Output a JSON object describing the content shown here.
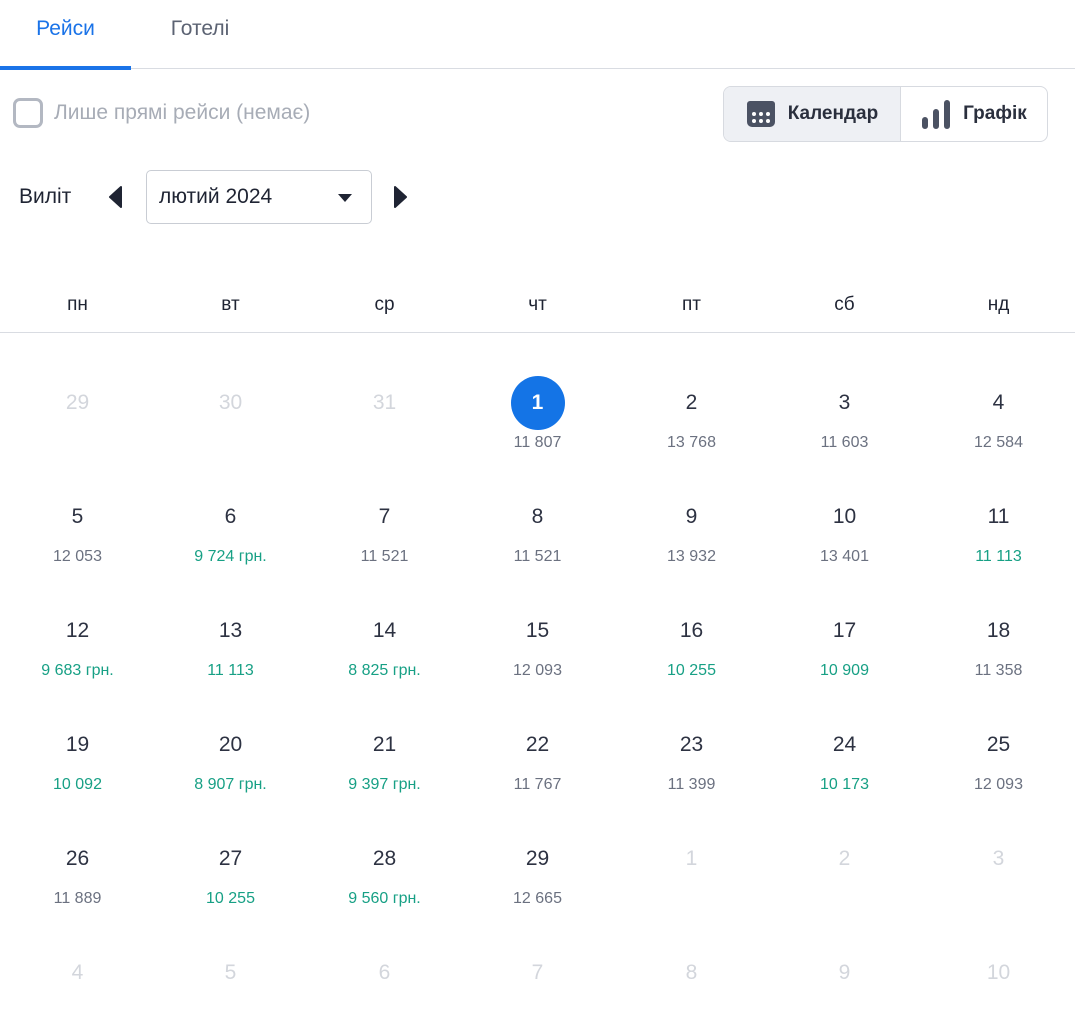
{
  "tabs": [
    {
      "label": "Рейси",
      "active": true
    },
    {
      "label": "Готелі",
      "active": false
    }
  ],
  "filters": {
    "direct_label": "Лише прямі рейси (немає)",
    "direct_checked": false
  },
  "view_toggle": {
    "calendar_label": "Календар",
    "chart_label": "Графік",
    "active": "calendar"
  },
  "departure": {
    "label": "Виліт",
    "month": "лютий 2024"
  },
  "weekdays": [
    "пн",
    "вт",
    "ср",
    "чт",
    "пт",
    "сб",
    "нд"
  ],
  "colors": {
    "accent": "#1a73e8",
    "selected": "#1474e6",
    "low_price": "#17a085"
  },
  "calendar": [
    {
      "day": "29",
      "muted": true
    },
    {
      "day": "30",
      "muted": true
    },
    {
      "day": "31",
      "muted": true
    },
    {
      "day": "1",
      "price": "11 807",
      "selected": true
    },
    {
      "day": "2",
      "price": "13 768"
    },
    {
      "day": "3",
      "price": "11 603"
    },
    {
      "day": "4",
      "price": "12 584"
    },
    {
      "day": "5",
      "price": "12 053"
    },
    {
      "day": "6",
      "price": "9 724 грн.",
      "low": true
    },
    {
      "day": "7",
      "price": "11 521"
    },
    {
      "day": "8",
      "price": "11 521"
    },
    {
      "day": "9",
      "price": "13 932"
    },
    {
      "day": "10",
      "price": "13 401"
    },
    {
      "day": "11",
      "price": "11 113",
      "low": true
    },
    {
      "day": "12",
      "price": "9 683 грн.",
      "low": true
    },
    {
      "day": "13",
      "price": "11 113",
      "low": true
    },
    {
      "day": "14",
      "price": "8 825 грн.",
      "low": true
    },
    {
      "day": "15",
      "price": "12 093"
    },
    {
      "day": "16",
      "price": "10 255",
      "low": true
    },
    {
      "day": "17",
      "price": "10 909",
      "low": true
    },
    {
      "day": "18",
      "price": "11 358"
    },
    {
      "day": "19",
      "price": "10 092",
      "low": true
    },
    {
      "day": "20",
      "price": "8 907 грн.",
      "low": true
    },
    {
      "day": "21",
      "price": "9 397 грн.",
      "low": true
    },
    {
      "day": "22",
      "price": "11 767"
    },
    {
      "day": "23",
      "price": "11 399"
    },
    {
      "day": "24",
      "price": "10 173",
      "low": true
    },
    {
      "day": "25",
      "price": "12 093"
    },
    {
      "day": "26",
      "price": "11 889"
    },
    {
      "day": "27",
      "price": "10 255",
      "low": true
    },
    {
      "day": "28",
      "price": "9 560 грн.",
      "low": true
    },
    {
      "day": "29",
      "price": "12 665"
    },
    {
      "day": "1",
      "muted": true
    },
    {
      "day": "2",
      "muted": true
    },
    {
      "day": "3",
      "muted": true
    },
    {
      "day": "4",
      "muted": true
    },
    {
      "day": "5",
      "muted": true
    },
    {
      "day": "6",
      "muted": true
    },
    {
      "day": "7",
      "muted": true
    },
    {
      "day": "8",
      "muted": true
    },
    {
      "day": "9",
      "muted": true
    },
    {
      "day": "10",
      "muted": true
    }
  ]
}
